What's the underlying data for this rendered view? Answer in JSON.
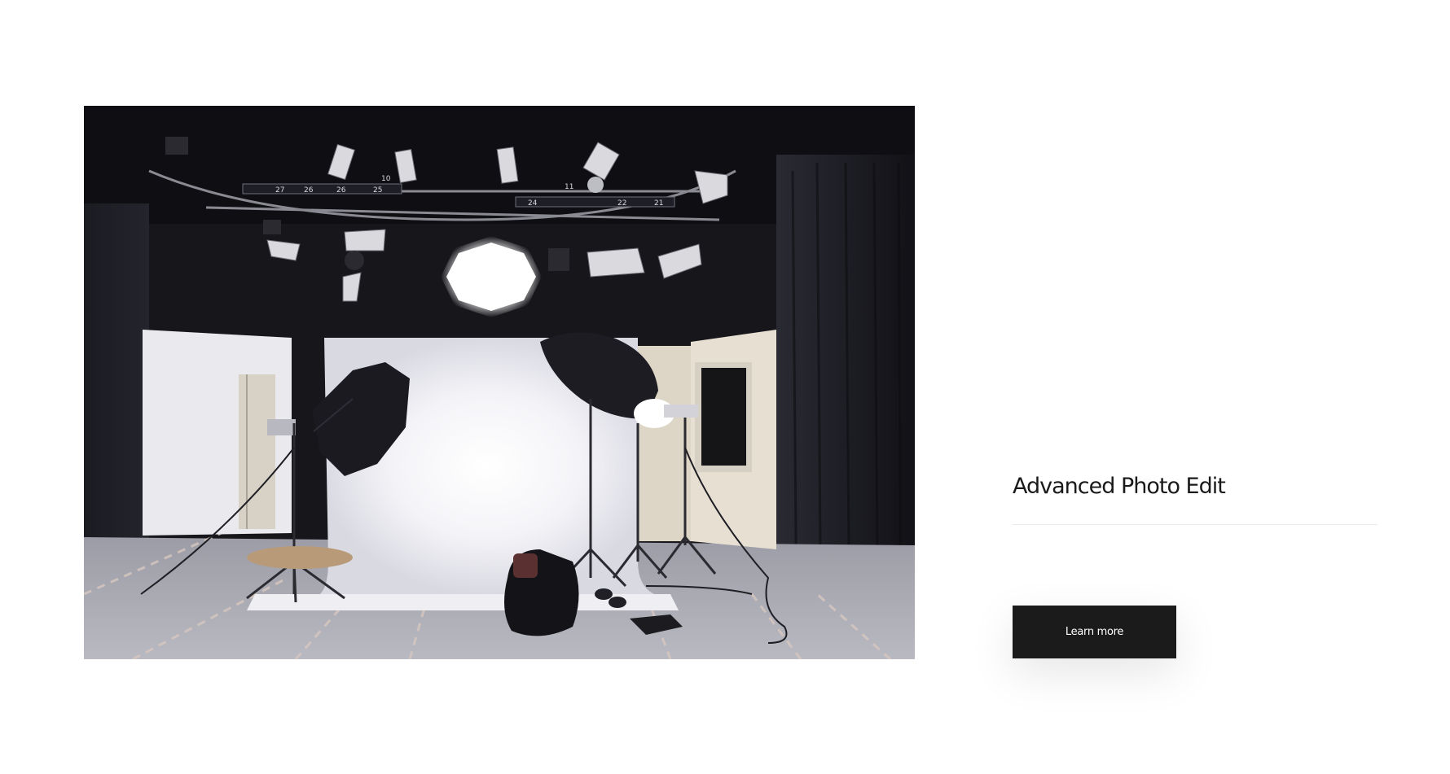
{
  "hero_image": {
    "subject": "photo-studio-with-softboxes",
    "alt": ""
  },
  "content": {
    "title": "Advanced Photo Edit",
    "cta_label": "Learn more"
  },
  "colors": {
    "background": "#ffffff",
    "button_bg": "#1b1b1b",
    "button_text": "#ffffff",
    "title_text": "#1a1a1a",
    "divider": "#ececec"
  }
}
